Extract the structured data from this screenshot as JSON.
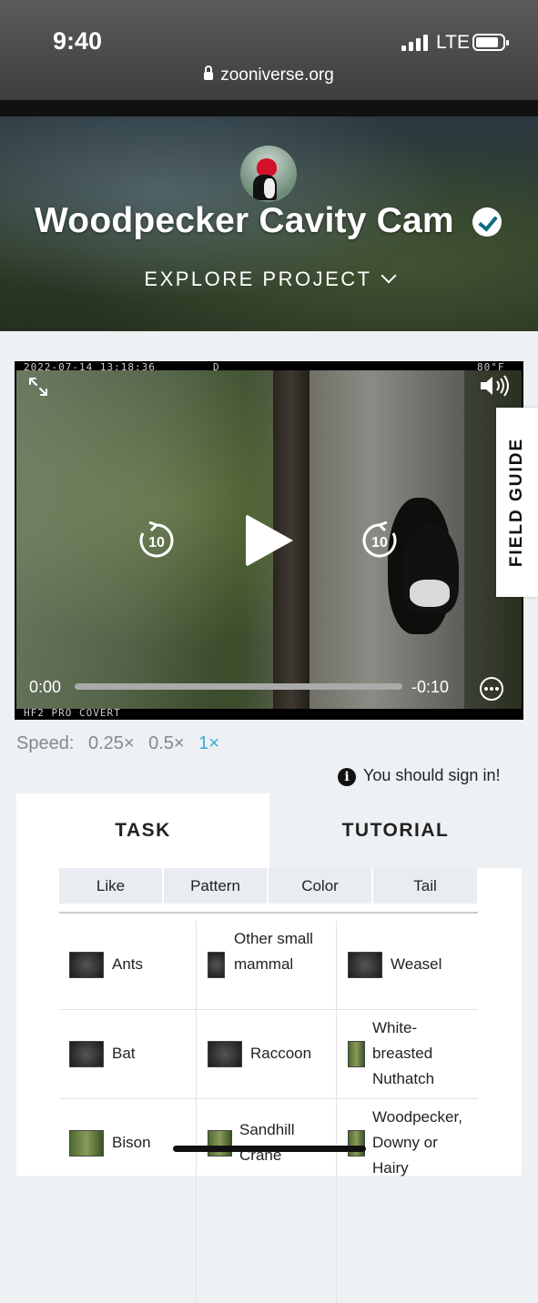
{
  "status_bar": {
    "time": "9:40",
    "network": "LTE",
    "url": "zooniverse.org"
  },
  "header": {
    "title": "Woodpecker Cavity Cam",
    "explore_label": "EXPLORE PROJECT"
  },
  "video": {
    "timestamp": "2022-07-14 13:18:36",
    "mode": "D",
    "temperature": "80°F",
    "camera": "HF2 PRO COVERT",
    "rewind_label": "10",
    "forward_label": "10",
    "current_time": "0:00",
    "remaining_time": "-0:10",
    "progress": 0
  },
  "field_guide_label": "FIELD GUIDE",
  "speed": {
    "label": "Speed:",
    "options": [
      "0.25×",
      "0.5×",
      "1×"
    ],
    "selected": "1×"
  },
  "sign_in_notice": "You should sign in!",
  "tabs": {
    "task": "TASK",
    "tutorial": "TUTORIAL"
  },
  "filters": [
    "Like",
    "Pattern",
    "Color",
    "Tail"
  ],
  "choices": [
    [
      "Ants",
      "Other small mammal",
      "Weasel"
    ],
    [
      "Bat",
      "Raccoon",
      "White-breasted Nuthatch"
    ],
    [
      "Bison",
      "Sandhill Crane",
      "Woodpecker, Downy or Hairy"
    ]
  ],
  "colors": {
    "accent": "#3fa5d9",
    "verified": "#0b6e84",
    "tab_inactive": "#eef1f4"
  }
}
